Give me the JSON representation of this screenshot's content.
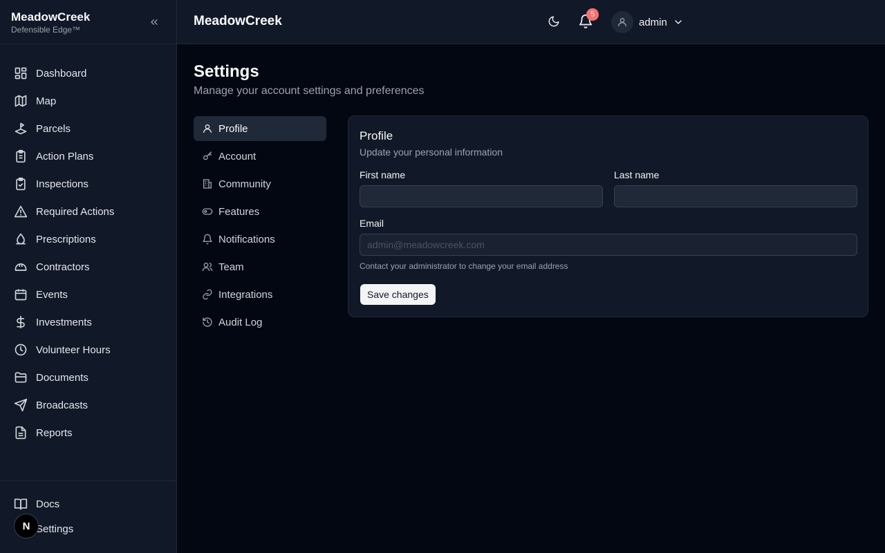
{
  "brand": {
    "name": "MeadowCreek",
    "tagline": "Defensible Edge™"
  },
  "sidebar": {
    "items": [
      {
        "label": "Dashboard",
        "icon": "dashboard-icon"
      },
      {
        "label": "Map",
        "icon": "map-icon"
      },
      {
        "label": "Parcels",
        "icon": "parcels-icon"
      },
      {
        "label": "Action Plans",
        "icon": "clipboard-list-icon"
      },
      {
        "label": "Inspections",
        "icon": "clipboard-check-icon"
      },
      {
        "label": "Required Actions",
        "icon": "warning-icon"
      },
      {
        "label": "Prescriptions",
        "icon": "flame-icon"
      },
      {
        "label": "Contractors",
        "icon": "hard-hat-icon"
      },
      {
        "label": "Events",
        "icon": "calendar-icon"
      },
      {
        "label": "Investments",
        "icon": "dollar-icon"
      },
      {
        "label": "Volunteer Hours",
        "icon": "clock-icon"
      },
      {
        "label": "Documents",
        "icon": "folder-icon"
      },
      {
        "label": "Broadcasts",
        "icon": "send-icon"
      },
      {
        "label": "Reports",
        "icon": "file-text-icon"
      }
    ],
    "bottom_items": [
      {
        "label": "Docs",
        "icon": "book-icon"
      },
      {
        "label": "Settings",
        "icon": "settings-icon"
      }
    ],
    "badge_letter": "N"
  },
  "header": {
    "title": "MeadowCreek",
    "notifications_count": "5",
    "user": "admin"
  },
  "page": {
    "title": "Settings",
    "subtitle": "Manage your account settings and preferences"
  },
  "settings_nav": [
    {
      "label": "Profile",
      "active": true
    },
    {
      "label": "Account"
    },
    {
      "label": "Community"
    },
    {
      "label": "Features"
    },
    {
      "label": "Notifications"
    },
    {
      "label": "Team"
    },
    {
      "label": "Integrations"
    },
    {
      "label": "Audit Log"
    }
  ],
  "profile": {
    "title": "Profile",
    "subtitle": "Update your personal information",
    "first_name_label": "First name",
    "first_name_value": "",
    "last_name_label": "Last name",
    "last_name_value": "",
    "email_label": "Email",
    "email_value": "admin@meadowcreek.com",
    "email_hint": "Contact your administrator to change your email address",
    "save_label": "Save changes"
  }
}
